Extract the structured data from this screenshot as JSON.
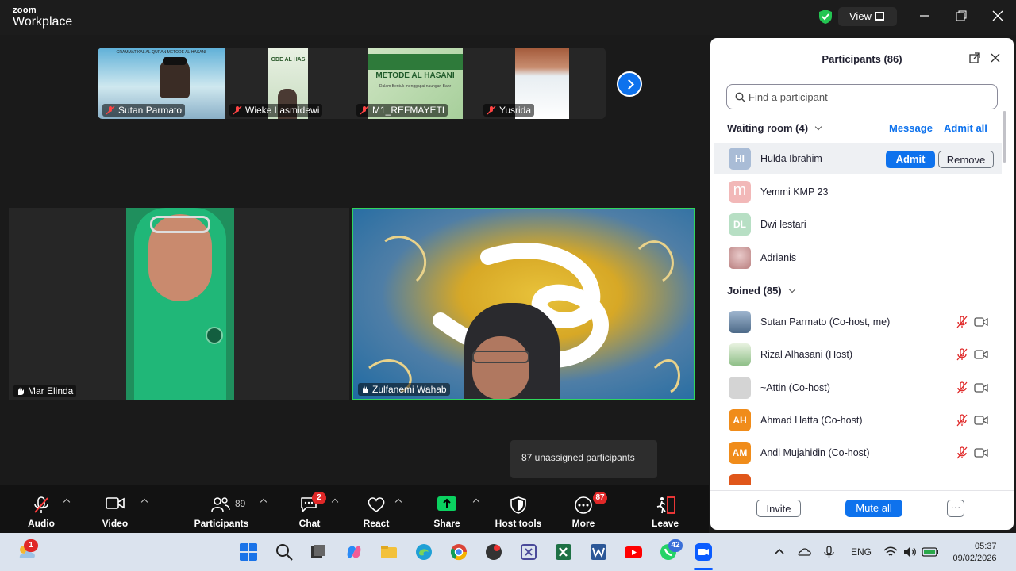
{
  "app": {
    "brand_top": "zoom",
    "brand_bottom": "Workplace",
    "view_label": "View"
  },
  "strip": [
    {
      "name": "Sutan Parmato"
    },
    {
      "name": "Wieke Lasmidewi"
    },
    {
      "name": "M1_REFMAYETI"
    },
    {
      "name": "Yusrida"
    }
  ],
  "strip_text": {
    "book1": "ODE AL HAS",
    "book2": "METODE AL HASANI",
    "book2_sub": "Dalam Bentuk menggapai naungan Bahr",
    "banner": "GRAMMATIKAL AL-QURAN METODE AL-HASANI"
  },
  "tiles": {
    "left_name": "Mar Elinda",
    "right_name": "Zulfanemi Wahab"
  },
  "tooltip": "87 unassigned participants",
  "toolbar": {
    "audio": "Audio",
    "video": "Video",
    "participants": "Participants",
    "participants_count": "89",
    "chat": "Chat",
    "chat_badge": "2",
    "react": "React",
    "share": "Share",
    "host_tools": "Host tools",
    "more": "More",
    "more_badge": "87",
    "leave": "Leave"
  },
  "panel": {
    "title": "Participants (86)",
    "search_placeholder": "Find a participant",
    "waiting_label": "Waiting room (4)",
    "message": "Message",
    "admit_all": "Admit all",
    "admit": "Admit",
    "remove": "Remove",
    "joined_label": "Joined (85)",
    "invite": "Invite",
    "mute_all": "Mute all",
    "waiting": [
      {
        "initials": "HI",
        "name": "Hulda Ibrahim",
        "color": "#a9bcd6"
      },
      {
        "initials": "m",
        "name": "Yemmi KMP 23",
        "color": "#f2b8b8"
      },
      {
        "initials": "DL",
        "name": "Dwi lestari",
        "color": "#b7dfc4"
      },
      {
        "initials": "",
        "name": "Adrianis",
        "color": "#d9a7a7"
      }
    ],
    "joined": [
      {
        "initials": "",
        "name": "Sutan Parmato (Co-host, me)",
        "color": "#6e8cab"
      },
      {
        "initials": "",
        "name": "Rizal Alhasani (Host)",
        "color": "#9fc89a"
      },
      {
        "initials": "",
        "name": "~Attin (Co-host)",
        "color": "#cfcfcf"
      },
      {
        "initials": "AH",
        "name": "Ahmad Hatta (Co-host)",
        "color": "#f08c1a"
      },
      {
        "initials": "AM",
        "name": "Andi Mujahidin (Co-host)",
        "color": "#f08c1a"
      }
    ]
  },
  "taskbar": {
    "weather_badge": "1",
    "whatsapp_badge": "42",
    "lang": "ENG",
    "time": "05:37",
    "date": "09/02/2026"
  }
}
